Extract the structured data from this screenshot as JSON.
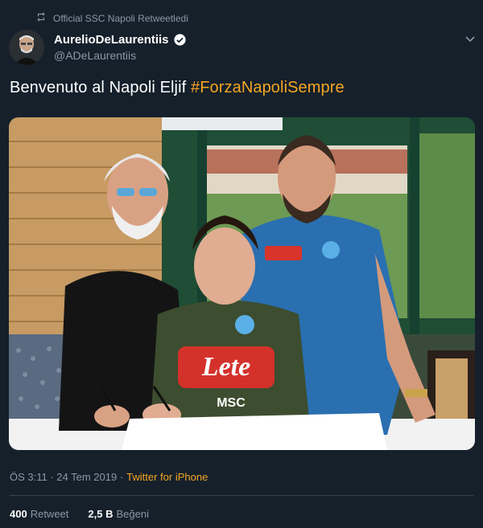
{
  "retweet_context": {
    "label": "Official SSC Napoli Retweetledi"
  },
  "author": {
    "display_name": "AurelioDeLaurentiis",
    "handle": "@ADeLaurentiis",
    "verified": true
  },
  "tweet": {
    "text": "Benvenuto al Napoli Eljif",
    "hashtag": "#ForzaNapoliSempre"
  },
  "media": {
    "shirt_sponsor_main": "Lete",
    "shirt_sponsor_small": "MSC",
    "icons": [
      "napoli-crest-icon",
      "kappa-logo-icon"
    ]
  },
  "meta": {
    "time": "ÖS 3:11 · 24 Tem 2019 ·",
    "source": "Twitter for iPhone"
  },
  "stats": {
    "retweets_count": "400",
    "retweets_label": "Retweet",
    "likes_count": "2,5 B",
    "likes_label": "Beğeni"
  },
  "colors": {
    "background": "#15202b",
    "accent": "#f5a623",
    "muted_text": "#8899a6",
    "divider": "#38444d"
  }
}
